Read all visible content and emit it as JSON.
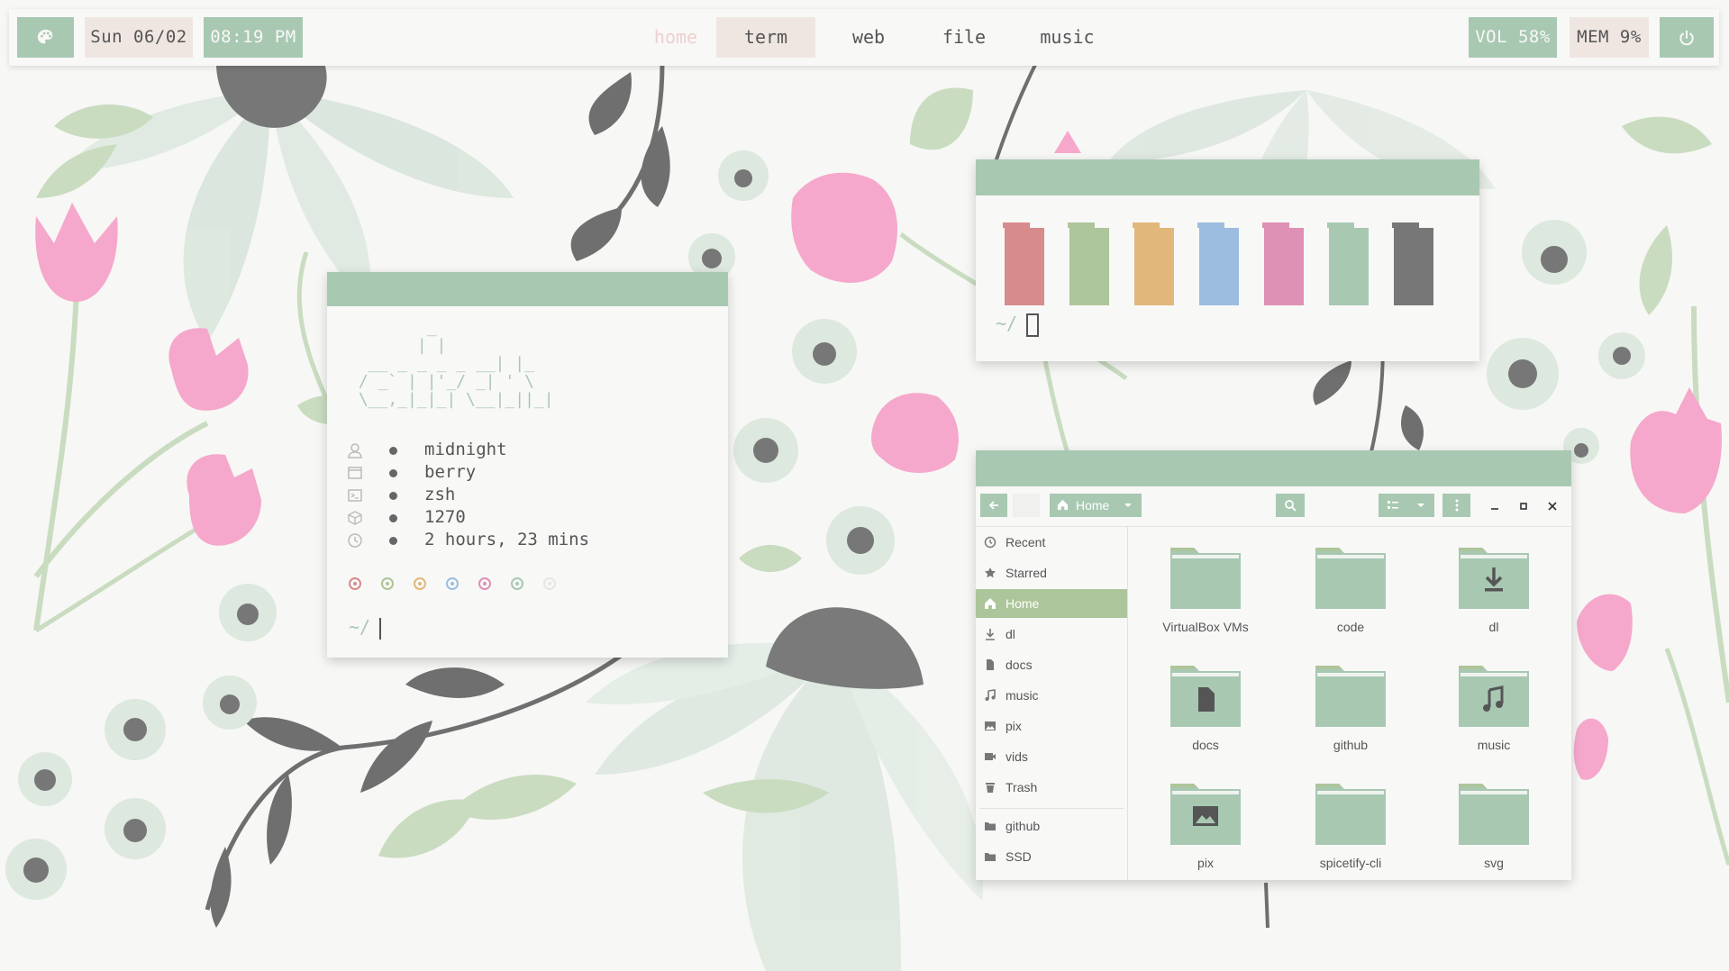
{
  "colors": {
    "accent": "#a8c8b2",
    "accent_dark": "#adc59a",
    "beige": "#efe6e2",
    "text": "#555555",
    "background": "#f7f7f5",
    "palette": [
      "#d78b8b",
      "#adc59a",
      "#e2b77b",
      "#9cbde0",
      "#df90b5",
      "#a8c8b2",
      "#777777"
    ]
  },
  "topbar": {
    "palette_icon": "palette-icon",
    "date": "Sun 06/02",
    "time": "08:19 PM",
    "workspaces": [
      {
        "label": "home",
        "state": "inactive"
      },
      {
        "label": "term",
        "state": "active"
      },
      {
        "label": "web",
        "state": "normal"
      },
      {
        "label": "file",
        "state": "normal"
      },
      {
        "label": "music",
        "state": "normal"
      }
    ],
    "volume": "VOL 58%",
    "memory": "MEM 9%",
    "power_icon": "power-icon"
  },
  "fetch": {
    "ascii_art": "        _\n       | |\n  __ _ _ _ _ __| |_\n / _` | |'_/ _| ' \\\n \\__,_|_|_| \\__|_||_|",
    "rows": [
      {
        "icon": "user-icon",
        "value": "midnight"
      },
      {
        "icon": "window-icon",
        "value": "berry"
      },
      {
        "icon": "terminal-icon",
        "value": "zsh"
      },
      {
        "icon": "package-icon",
        "value": "1270"
      },
      {
        "icon": "clock-icon",
        "value": "2 hours, 23 mins"
      }
    ],
    "color_dots": [
      "#d78b8b",
      "#adc59a",
      "#e2b77b",
      "#9cbde0",
      "#df90b5",
      "#a8c8b2",
      "#e6e6e6"
    ],
    "prompt": "~/"
  },
  "colorterm": {
    "prompt": "~/"
  },
  "filemanager": {
    "location": "Home",
    "sidebar": [
      {
        "icon": "clock-icon",
        "label": "Recent"
      },
      {
        "icon": "star-icon",
        "label": "Starred"
      },
      {
        "icon": "home-icon",
        "label": "Home",
        "active": true
      },
      {
        "icon": "download-icon",
        "label": "dl"
      },
      {
        "icon": "document-icon",
        "label": "docs"
      },
      {
        "icon": "music-note-icon",
        "label": "music"
      },
      {
        "icon": "image-icon",
        "label": "pix"
      },
      {
        "icon": "video-icon",
        "label": "vids"
      },
      {
        "icon": "trash-icon",
        "label": "Trash"
      },
      {
        "icon": "folder-icon",
        "label": "github"
      },
      {
        "icon": "folder-icon",
        "label": "SSD"
      }
    ],
    "folders": [
      {
        "name": "VirtualBox VMs",
        "emblem": ""
      },
      {
        "name": "code",
        "emblem": ""
      },
      {
        "name": "dl",
        "emblem": "download"
      },
      {
        "name": "docs",
        "emblem": "document"
      },
      {
        "name": "github",
        "emblem": ""
      },
      {
        "name": "music",
        "emblem": "music"
      },
      {
        "name": "pix",
        "emblem": "image"
      },
      {
        "name": "spicetify-cli",
        "emblem": ""
      },
      {
        "name": "svg",
        "emblem": ""
      }
    ]
  }
}
